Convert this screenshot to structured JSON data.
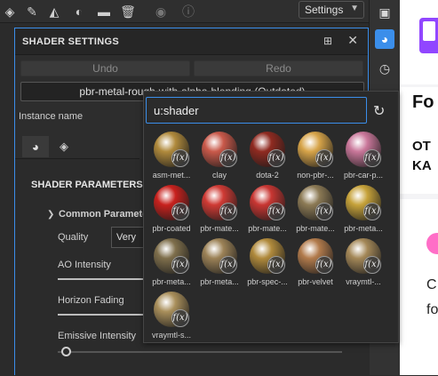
{
  "toolbar": {
    "icons": [
      "paint-bucket-icon",
      "brush-icon",
      "fill-icon",
      "material-icon",
      "folder-icon",
      "trash-icon"
    ],
    "settings_value": "Settings"
  },
  "panel": {
    "title": "SHADER SETTINGS",
    "undo_label": "Undo",
    "redo_label": "Redo",
    "shader_name": "pbr-metal-rough-with-alpha-blending (Outdated)",
    "instance_label": "Instance name",
    "section_title": "SHADER PARAMETERS",
    "group_title": "Common Parameters",
    "quality_label": "Quality",
    "quality_value": "Very",
    "ao_label": "AO Intensity",
    "horizon_label": "Horizon Fading",
    "emissive_label": "Emissive Intensity"
  },
  "popup": {
    "search_value": "u:shader",
    "fx_symbol": "f(x)",
    "tiles": [
      {
        "label": "asm-met...",
        "color": "#b08a3c"
      },
      {
        "label": "clay",
        "color": "#c9594a"
      },
      {
        "label": "dota-2",
        "color": "#8f2a20"
      },
      {
        "label": "non-pbr-...",
        "color": "#d7a449"
      },
      {
        "label": "pbr-car-p...",
        "color": "#c9779a"
      },
      {
        "label": "pbr-coated",
        "color": "#c8211d"
      },
      {
        "label": "pbr-mate...",
        "color": "#cf3a34"
      },
      {
        "label": "pbr-mate...",
        "color": "#c83632"
      },
      {
        "label": "pbr-mate...",
        "color": "#8c7a55"
      },
      {
        "label": "pbr-meta...",
        "color": "#c6a23a"
      },
      {
        "label": "pbr-meta...",
        "color": "#7f6f4c"
      },
      {
        "label": "pbr-meta...",
        "color": "#9c8257"
      },
      {
        "label": "pbr-spec-...",
        "color": "#b08a3c"
      },
      {
        "label": "pbr-velvet",
        "color": "#b27b4c"
      },
      {
        "label": "vraymtl-...",
        "color": "#a48858"
      },
      {
        "label": "vraymtl-s...",
        "color": "#a98f5b"
      }
    ]
  },
  "web": {
    "heading": "Fo",
    "sub1": "OT",
    "sub2": "KA",
    "text1": "C",
    "text2": "fo"
  },
  "colors": {
    "accent": "#3b8eea",
    "brand": "#9146ff"
  }
}
